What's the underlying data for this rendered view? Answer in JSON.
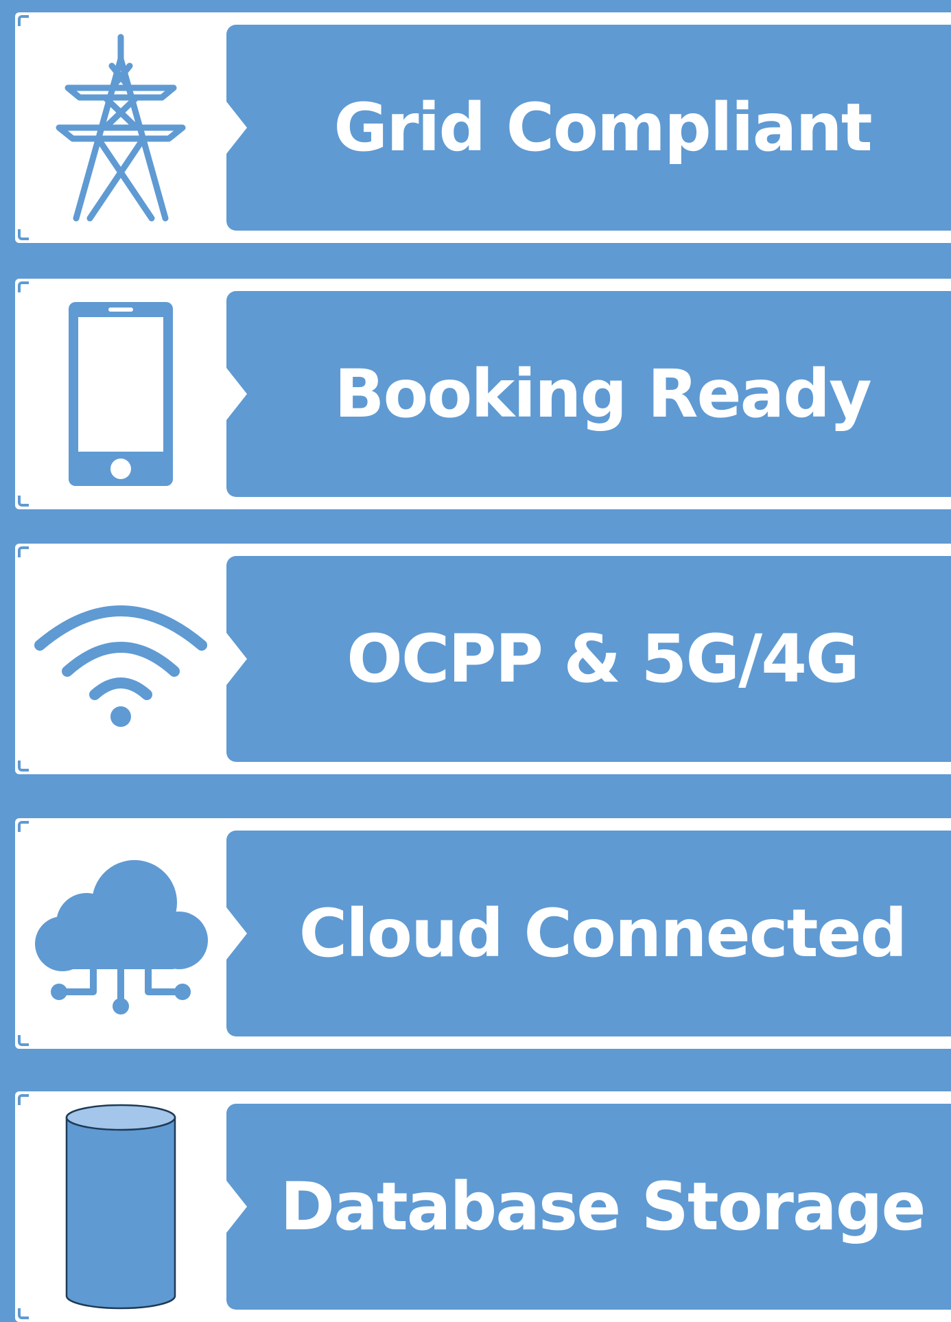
{
  "colors": {
    "background": "#5f9ad3",
    "card": "#ffffff",
    "icon": "#5f9ad3",
    "text": "#ffffff"
  },
  "features": [
    {
      "label": "Grid Compliant",
      "icon": "transmission-tower-icon"
    },
    {
      "label": "Booking Ready",
      "icon": "smartphone-icon"
    },
    {
      "label": "OCPP & 5G/4G",
      "icon": "wifi-icon"
    },
    {
      "label": "Cloud Connected",
      "icon": "cloud-network-icon"
    },
    {
      "label": "Database Storage",
      "icon": "database-cylinder-icon"
    }
  ]
}
